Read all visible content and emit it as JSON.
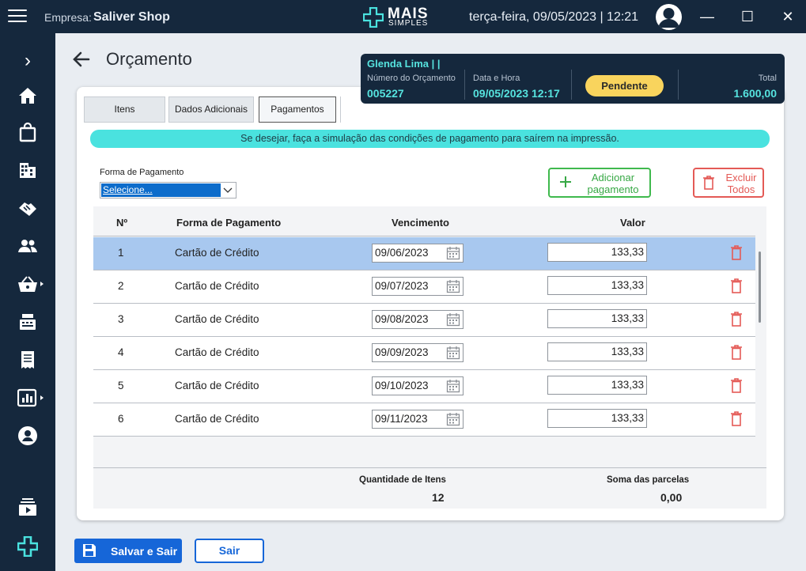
{
  "titlebar": {
    "empresa_label": "Empresa:",
    "empresa_name": "Saliver Shop",
    "logo_line1": "MAIS",
    "logo_line2": "SIMPLES",
    "datetime": "terça-feira, 09/05/2023 | 12:21",
    "minimize": "—",
    "maximize": "☐",
    "close": "✕"
  },
  "sidebar": {
    "expand": "›",
    "items": [
      "home-icon",
      "shopping-bag-icon",
      "building-icon",
      "handshake-icon",
      "people-icon",
      "basket-icon",
      "cash-register-icon",
      "receipt-icon",
      "chart-icon",
      "user-circle-icon",
      "play-stack-icon",
      "mais-simples-cross-icon"
    ]
  },
  "page": {
    "title": "Orçamento"
  },
  "infocard": {
    "client": "Glenda Lima |  |",
    "numero_label": "Número do Orçamento",
    "numero_value": "005227",
    "data_label": "Data e Hora",
    "data_value": "09/05/2023 12:17",
    "status": "Pendente",
    "total_label": "Total",
    "total_value": "1.600,00"
  },
  "tabs": [
    "Itens",
    "Dados Adicionais",
    "Pagamentos"
  ],
  "active_tab": "Pagamentos",
  "banner": "Se desejar, faça a simulação das condições de pagamento para saírem na impressão.",
  "form": {
    "forma_label": "Forma de Pagamento",
    "forma_value": "Selecione...",
    "add_button": "Adicionar pagamento",
    "delete_all_button": "Excluir Todos"
  },
  "table": {
    "headers": {
      "n": "Nº",
      "forma": "Forma de Pagamento",
      "vencimento": "Vencimento",
      "valor": "Valor"
    },
    "rows": [
      {
        "n": "1",
        "forma": "Cartão de Crédito",
        "vencimento": "09/06/2023",
        "valor": "133,33",
        "selected": true
      },
      {
        "n": "2",
        "forma": "Cartão de Crédito",
        "vencimento": "09/07/2023",
        "valor": "133,33"
      },
      {
        "n": "3",
        "forma": "Cartão de Crédito",
        "vencimento": "09/08/2023",
        "valor": "133,33"
      },
      {
        "n": "4",
        "forma": "Cartão de Crédito",
        "vencimento": "09/09/2023",
        "valor": "133,33"
      },
      {
        "n": "5",
        "forma": "Cartão de Crédito",
        "vencimento": "09/10/2023",
        "valor": "133,33"
      },
      {
        "n": "6",
        "forma": "Cartão de Crédito",
        "vencimento": "09/11/2023",
        "valor": "133,33"
      }
    ],
    "footer": {
      "qtd_label": "Quantidade de Itens",
      "qtd_value": "12",
      "soma_label": "Soma das parcelas",
      "soma_value": "0,00"
    }
  },
  "actions": {
    "save": "Salvar e Sair",
    "exit": "Sair"
  },
  "colors": {
    "dark": "#15283d",
    "accent": "#4ae2df",
    "primary": "#1666d8",
    "green": "#3fb94d",
    "red": "#e45a56",
    "status": "#f9d45d"
  }
}
